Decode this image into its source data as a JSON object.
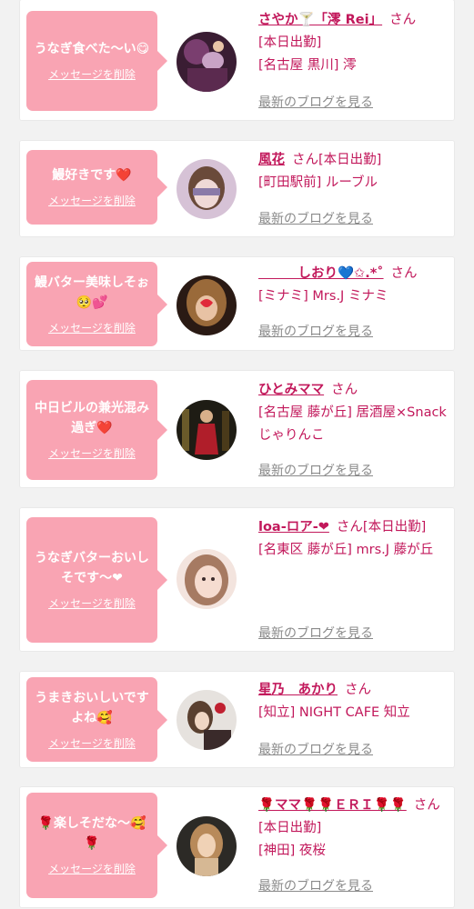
{
  "delete_label": "メッセージを削除",
  "blog_label": "最新のブログを見る",
  "san": "さん",
  "colors": {
    "bubble": "#f9a4b3",
    "name": "#c2185b",
    "link_gray": "#8a8a8a",
    "background": "#f2f2f2"
  },
  "cards": [
    {
      "message": "うなぎ食べた〜い😋",
      "name": "さやか🍸「澪 Rei」",
      "lines": [
        "[本日出勤]",
        "[名古屋 黒川] 澪"
      ]
    },
    {
      "message": "鰻好きです❤️",
      "name": "風花",
      "inline": "[本日出勤]",
      "lines": [
        "[町田駅前] ルーブル"
      ]
    },
    {
      "message": "鰻バター美味しそぉ🥺💕",
      "name": "　　　しおり💙✩.*˚",
      "lines": [
        "[ミナミ] Mrs.J ミナミ"
      ]
    },
    {
      "message": "中日ビルの兼光混み過ぎ❤️",
      "name": "ひとみママ",
      "lines": [
        "[名古屋 藤が丘] 居酒屋×Snack じゃりんこ"
      ]
    },
    {
      "message": "うなぎバターおいしそです〜❤",
      "name": "loa-ロア-❤",
      "inline": "[本日出勤]",
      "lines": [
        "[名東区 藤が丘] mrs.J 藤が丘"
      ]
    },
    {
      "message": "うまきおいしいですよね🥰",
      "name": "星乃　あかり",
      "lines": [
        "[知立] NIGHT CAFE 知立"
      ]
    },
    {
      "message": "🌹楽しそだな〜🥰🌹",
      "name": "🌹ママ🌹🌹ＥＲＩ🌹🌹",
      "inline": "[本日出勤]",
      "lines": [
        "[神田] 夜桜"
      ]
    }
  ]
}
